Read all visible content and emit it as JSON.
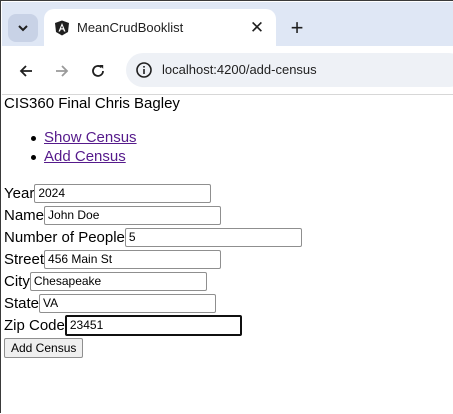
{
  "browser": {
    "tab_title": "MeanCrudBooklist",
    "url": "localhost:4200/add-census",
    "new_tab_symbol": "+",
    "close_symbol": "✕"
  },
  "page": {
    "title": "CIS360 Final Chris Bagley",
    "nav": [
      {
        "label": "Show Census"
      },
      {
        "label": "Add Census"
      }
    ],
    "form": {
      "year_label": "Year",
      "year_value": "2024",
      "name_label": "Name",
      "name_value": "John Doe",
      "people_label": "Number of People",
      "people_value": "5",
      "street_label": "Street",
      "street_value": "456 Main St",
      "city_label": "City",
      "city_value": "Chesapeake",
      "state_label": "State",
      "state_value": "VA",
      "zip_label": "Zip Code",
      "zip_value": "23451",
      "submit_label": "Add Census"
    }
  }
}
